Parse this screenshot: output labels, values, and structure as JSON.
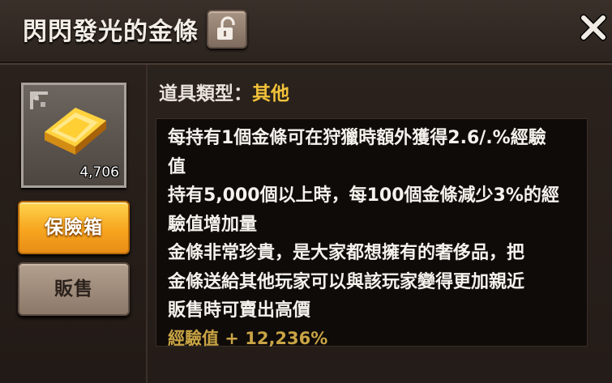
{
  "window": {
    "title": "閃閃發光的金條",
    "lock_icon": "unlock-icon",
    "close_icon": "close-icon"
  },
  "item": {
    "icon": "gold-bar-icon",
    "quantity": "4,706"
  },
  "buttons": {
    "safe_label": "保險箱",
    "sell_label": "販售"
  },
  "details": {
    "type_label": "道具類型：",
    "type_value": "其他",
    "description_lines": [
      "每持有1個金條可在狩獵時額外獲得2.6/.%經驗",
      "值",
      "持有5,000個以上時，每100個金條減少3%的經",
      "驗值增加量",
      "金條非常珍貴，是大家都想擁有的奢侈品，把",
      "金條送給其他玩家可以與該玩家變得更加親近",
      "販售時可賣出高價"
    ],
    "exp_bonus": "經驗值 + 12,236%"
  },
  "colors": {
    "accent_gold": "#f2c23a",
    "exp_text": "#c9a445",
    "safe_button": "#f7a51f",
    "sell_button": "#a08d7c"
  }
}
